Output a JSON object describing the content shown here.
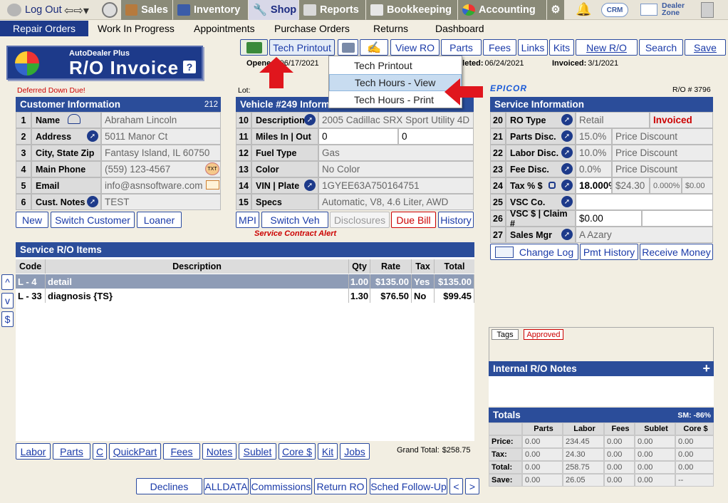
{
  "nav": {
    "logout": "Log Out",
    "sales": "Sales",
    "inventory": "Inventory",
    "shop": "Shop",
    "reports": "Reports",
    "bookkeeping": "Bookkeeping",
    "accounting": "Accounting",
    "crm": "CRM",
    "dealer_zone_1": "Dealer",
    "dealer_zone_2": "Zone"
  },
  "subnav": [
    "Repair Orders",
    "Work In Progress",
    "Appointments",
    "Purchase Orders",
    "Returns",
    "Dashboard"
  ],
  "toolbar": {
    "tech_printout": "Tech Printout",
    "view_ro": "View RO",
    "parts": "Parts",
    "fees": "Fees",
    "links": "Links",
    "kits": "Kits",
    "new_ro": "New R/O",
    "search": "Search",
    "save": "Save"
  },
  "logo": {
    "line1": "AutoDealer Plus",
    "line2": "R/O Invoice",
    "help": "?"
  },
  "dates": {
    "opened_label": "Opened:",
    "opened_value": "06/17/2021",
    "completed_label": "Completed:",
    "completed_value": "06/24/2021",
    "invoiced_label": "Invoiced:",
    "invoiced_value": "3/1/2021"
  },
  "menu": {
    "items": [
      "Tech Printout",
      "Tech Hours - View",
      "Tech Hours - Print"
    ]
  },
  "deferred": "Deferred Down Due!",
  "lot": "Lot:",
  "epicor": "EPICOR",
  "ro_number": "R/O # 3796",
  "customer": {
    "title": "Customer Information",
    "count": "212",
    "rows": [
      {
        "n": "1",
        "label": "Name",
        "value": "Abraham Lincoln"
      },
      {
        "n": "2",
        "label": "Address",
        "value": "5011 Manor Ct"
      },
      {
        "n": "3",
        "label": "City, State Zip",
        "value": "Fantasy Island, IL 60750"
      },
      {
        "n": "4",
        "label": "Main Phone",
        "value": "(559) 123-4567"
      },
      {
        "n": "5",
        "label": "Email",
        "value": "info@asnsoftware.com"
      },
      {
        "n": "6",
        "label": "Cust. Notes",
        "value": "TEST"
      }
    ],
    "buttons": [
      "New",
      "Switch Customer",
      "Loaner"
    ]
  },
  "vehicle": {
    "title": "Vehicle #249 Information",
    "rows": [
      {
        "n": "10",
        "label": "Description",
        "value": "2005 Cadillac SRX Sport Utility 4D"
      },
      {
        "n": "11",
        "label": "Miles In | Out",
        "value": "0",
        "value2": "0"
      },
      {
        "n": "12",
        "label": "Fuel Type",
        "value": "Gas"
      },
      {
        "n": "13",
        "label": "Color",
        "value": "No Color"
      },
      {
        "n": "14",
        "label": "VIN | Plate",
        "value": "1GYEE63A750164751"
      },
      {
        "n": "15",
        "label": "Specs",
        "value": "Automatic, V8, 4.6 Liter, AWD"
      }
    ],
    "buttons": [
      "MPI",
      "Switch Veh",
      "Disclosures",
      "Due Bill",
      "History"
    ],
    "alert": "Service Contract Alert"
  },
  "service": {
    "title": "Service Information",
    "rows": [
      {
        "n": "20",
        "label": "RO Type",
        "value": "Retail",
        "value2": "Invoiced"
      },
      {
        "n": "21",
        "label": "Parts Disc.",
        "value": "15.0%",
        "value2": "Price Discount"
      },
      {
        "n": "22",
        "label": "Labor Disc.",
        "value": "10.0%",
        "value2": "Price Discount"
      },
      {
        "n": "23",
        "label": "Fee Disc.",
        "value": "0.0%",
        "value2": "Price Discount"
      },
      {
        "n": "24",
        "label": "Tax % $",
        "value": "18.000%",
        "value2": "$24.30",
        "value3": "0.000%",
        "value4": "$0.00"
      },
      {
        "n": "25",
        "label": "VSC Co.",
        "value": ""
      },
      {
        "n": "26",
        "label": "VSC $ | Claim #",
        "value": "$0.00"
      },
      {
        "n": "27",
        "label": "Sales Mgr",
        "value": "A Azary"
      }
    ],
    "buttons": [
      "Change Log",
      "Pmt History",
      "Receive Money"
    ]
  },
  "items": {
    "title": "Service R/O Items",
    "headers": [
      "Code",
      "Description",
      "Qty",
      "Rate",
      "Tax",
      "Total"
    ],
    "rows": [
      {
        "code": "L - 4",
        "desc": "detail",
        "qty": "1.00",
        "rate": "$135.00",
        "tax": "Yes",
        "total": "$135.00"
      },
      {
        "code": "L - 33",
        "desc": "diagnosis {TS}",
        "qty": "1.30",
        "rate": "$76.50",
        "tax": "No",
        "total": "$99.45"
      }
    ],
    "side_buttons": [
      "^",
      "v",
      "$"
    ],
    "bottom_buttons": [
      "Labor",
      "Parts",
      "C",
      "QuickPart",
      "Fees",
      "Notes",
      "Sublet",
      "Core $",
      "Kit",
      "Jobs"
    ],
    "grand_total_label": "Grand Total:",
    "grand_total": "$258.75"
  },
  "tags": {
    "label": "Tags",
    "approved": "Approved"
  },
  "notes": {
    "title": "Internal R/O Notes",
    "add": "+"
  },
  "totals": {
    "title": "Totals",
    "sm": "SM: -86%",
    "headers": [
      "",
      "Parts",
      "Labor",
      "Fees",
      "Sublet",
      "Core $"
    ],
    "rows": [
      {
        "label": "Price:",
        "vals": [
          "0.00",
          "234.45",
          "0.00",
          "0.00",
          "0.00"
        ]
      },
      {
        "label": "Tax:",
        "vals": [
          "0.00",
          "24.30",
          "0.00",
          "0.00",
          "0.00"
        ]
      },
      {
        "label": "Total:",
        "vals": [
          "0.00",
          "258.75",
          "0.00",
          "0.00",
          "0.00"
        ]
      },
      {
        "label": "Save:",
        "vals": [
          "0.00",
          "26.05",
          "0.00",
          "0.00",
          "--"
        ]
      }
    ]
  },
  "footer_buttons": [
    "Declines",
    "ALLDATA",
    "Commissions",
    "Return RO",
    "Sched Follow-Up",
    "<",
    ">"
  ]
}
